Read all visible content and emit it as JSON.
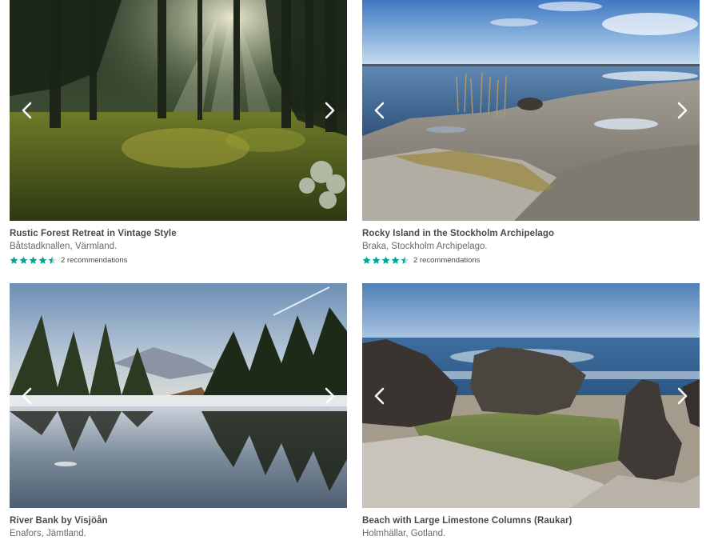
{
  "colors": {
    "star": "#00a699",
    "title": "#484848",
    "subtitle": "#6b6b6b"
  },
  "listings": [
    {
      "title": "Rustic Forest Retreat in Vintage Style",
      "location": "Båtstadknallen, Värmland.",
      "rating": 4.5,
      "recommendations": "2 recommendations",
      "photo": "sunlit-forest"
    },
    {
      "title": "Rocky Island in the Stockholm Archipelago",
      "location": "Braka, Stockholm Archipelago.",
      "rating": 4.5,
      "recommendations": "2 recommendations",
      "photo": "archipelago-rocks"
    },
    {
      "title": "River Bank by Visjöån",
      "location": "Enafors, Jämtland.",
      "photo": "river-forest"
    },
    {
      "title": "Beach with Large Limestone Columns (Raukar)",
      "location": "Holmhällar, Gotland.",
      "photo": "limestone-beach"
    }
  ],
  "icons": {
    "prev": "chevron-left-icon",
    "next": "chevron-right-icon",
    "star": "star-icon"
  }
}
